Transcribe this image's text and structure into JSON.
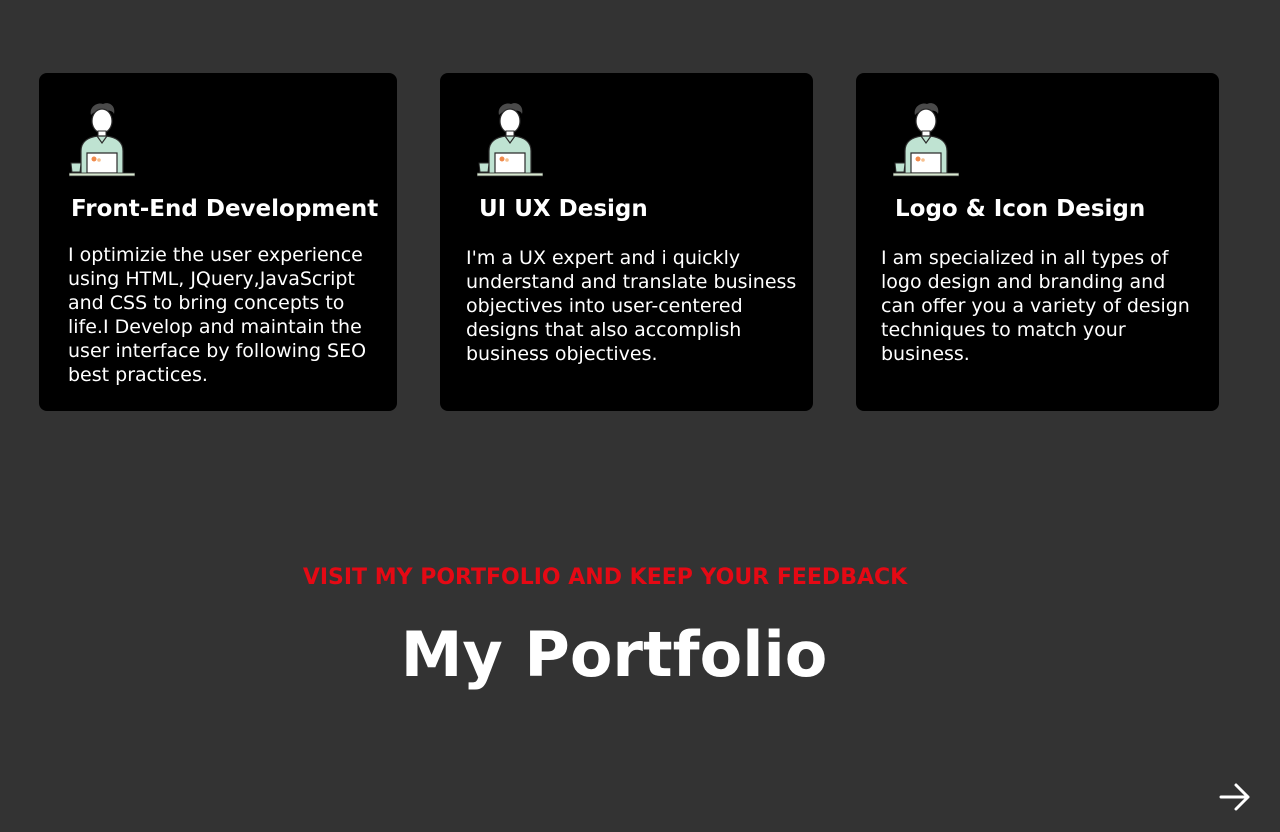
{
  "services": [
    {
      "title": "Front-End Development",
      "description": "I optimizie the user experience using HTML, JQuery,JavaScript and CSS to bring concepts to life.I Develop and maintain the user interface by following SEO best practices.",
      "icon": "developer-avatar-icon"
    },
    {
      "title": "UI UX Design",
      "description": "I'm a UX expert and i quickly understand and translate business objectives into user-centered designs that also accomplish business objectives.",
      "icon": "developer-avatar-icon"
    },
    {
      "title": "Logo & Icon Design",
      "description": "I am specialized in all types of logo design and branding and can offer you a variety of design techniques to match your business.",
      "icon": "developer-avatar-icon"
    }
  ],
  "portfolio": {
    "kicker": "VISIT MY PORTFOLIO AND KEEP YOUR FEEDBACK",
    "title": "My Portfolio"
  },
  "navigation": {
    "next_icon": "arrow-right-icon"
  },
  "colors": {
    "background": "#333333",
    "card": "#000000",
    "accent": "#e50914",
    "text": "#ffffff"
  }
}
